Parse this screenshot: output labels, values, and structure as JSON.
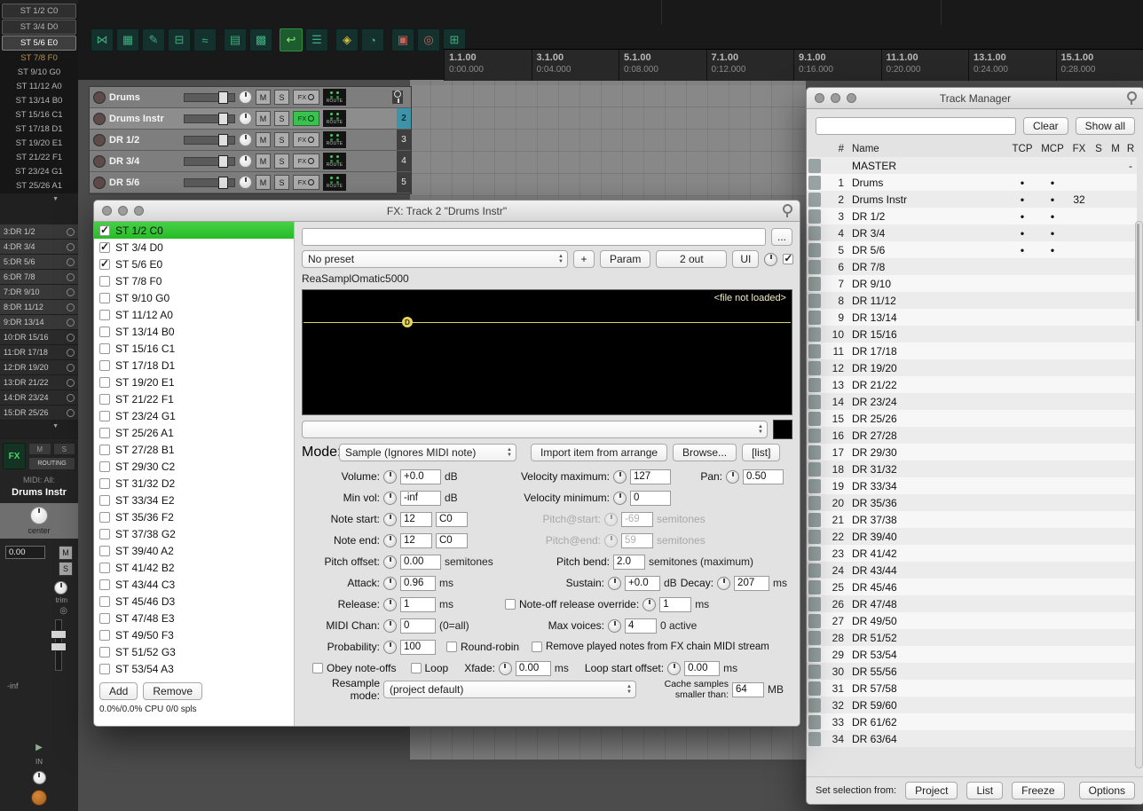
{
  "left_rail": {
    "collapse_arrow": "▼",
    "top_items": [
      {
        "label": "ST 1/2 C0",
        "boxed": true
      },
      {
        "label": "ST 3/4 D0",
        "boxed": true
      },
      {
        "label": "ST 5/6 E0",
        "boxed": true,
        "selected": true
      },
      {
        "label": "ST 7/8 F0",
        "armed": true
      },
      {
        "label": "ST 9/10 G0"
      },
      {
        "label": "ST 11/12 A0"
      },
      {
        "label": "ST 13/14 B0"
      },
      {
        "label": "ST 15/16 C1"
      },
      {
        "label": "ST 17/18 D1"
      },
      {
        "label": "ST 19/20 E1"
      },
      {
        "label": "ST 21/22 F1"
      },
      {
        "label": "ST 23/24 G1"
      },
      {
        "label": "ST 25/26 A1"
      }
    ],
    "dr_items": [
      {
        "label": "3:DR 1/2"
      },
      {
        "label": "4:DR 3/4"
      },
      {
        "label": "5:DR 5/6"
      },
      {
        "label": "6:DR 7/8"
      },
      {
        "label": "7:DR 9/10"
      },
      {
        "label": "8:DR 11/12"
      },
      {
        "label": "9:DR 13/14"
      },
      {
        "label": "10:DR 15/16",
        "dark": true
      },
      {
        "label": "11:DR 17/18",
        "dark": true
      },
      {
        "label": "12:DR 19/20",
        "dark": true
      },
      {
        "label": "13:DR 21/22",
        "dark": true
      },
      {
        "label": "14:DR 23/24",
        "dark": true
      },
      {
        "label": "15:DR 25/26",
        "dark": true
      }
    ],
    "mixer": {
      "fx_label": "FX",
      "mute_label": "M",
      "solo_label": "S",
      "routing_label": "ROUTING",
      "midi_label": "MIDI: All:",
      "track_name": "Drums Instr",
      "pan_label": "center",
      "volume_value": "0.00",
      "trim_label": "trim",
      "meter_label": "-inf",
      "input_label": "IN"
    }
  },
  "toolbar": {
    "items": [
      {
        "name": "crossfade-icon",
        "glyph": "⋈"
      },
      {
        "name": "item-group-icon",
        "glyph": "▦"
      },
      {
        "name": "envelope-pencil-icon",
        "glyph": "✎"
      },
      {
        "name": "split-view-icon",
        "glyph": "⊟"
      },
      {
        "name": "envelope-icon",
        "glyph": "≈"
      },
      {
        "name": "grid-icon",
        "glyph": "▤"
      },
      {
        "name": "snap-grid-icon",
        "glyph": "▩"
      },
      {
        "name": "ripple-edit-icon",
        "glyph": "↩",
        "active": true
      },
      {
        "name": "mixer-list-icon",
        "glyph": "☰"
      },
      {
        "name": "lock-icon",
        "glyph": "◈",
        "gold": true
      },
      {
        "name": "metronome-icon",
        "glyph": "◔"
      },
      {
        "name": "screenset-icon",
        "glyph": "▣",
        "red": true
      },
      {
        "name": "spiral-icon",
        "glyph": "◎",
        "red": true
      },
      {
        "name": "virtual-keyboard-icon",
        "glyph": "⊞"
      }
    ]
  },
  "ruler": {
    "markers": [
      {
        "bar": "1.1.00",
        "time": "0:00.000"
      },
      {
        "bar": "3.1.00",
        "time": "0:04.000"
      },
      {
        "bar": "5.1.00",
        "time": "0:08.000"
      },
      {
        "bar": "7.1.00",
        "time": "0:12.000"
      },
      {
        "bar": "9.1.00",
        "time": "0:16.000"
      },
      {
        "bar": "11.1.00",
        "time": "0:20.000"
      },
      {
        "bar": "13.1.00",
        "time": "0:24.000"
      },
      {
        "bar": "15.1.00",
        "time": "0:28.000"
      }
    ]
  },
  "tracks": {
    "labels": {
      "mute": "M",
      "solo": "S",
      "fx": "FX",
      "route": "ROUTE"
    },
    "rows": [
      {
        "name": "Drums",
        "num": "",
        "pin": true
      },
      {
        "name": "Drums Instr",
        "num": "2",
        "selected": true,
        "fx_on": true
      },
      {
        "name": "DR 1/2",
        "num": "3"
      },
      {
        "name": "DR 3/4",
        "num": "4"
      },
      {
        "name": "DR 5/6",
        "num": "5"
      }
    ]
  },
  "fx_window": {
    "title": "FX: Track 2 \"Drums Instr\"",
    "header": {
      "more_button": "...",
      "preset_value": "No preset",
      "add_preset_button": "+",
      "param_button": "Param",
      "outs_button": "2 out",
      "ui_button": "UI"
    },
    "list": {
      "add_button": "Add",
      "remove_button": "Remove",
      "status": "0.0%/0.0% CPU 0/0 spls",
      "items": [
        {
          "label": "ST 1/2 C0",
          "checked": true,
          "selected": true
        },
        {
          "label": "ST 3/4 D0",
          "checked": true
        },
        {
          "label": "ST 5/6 E0",
          "checked": true
        },
        {
          "label": "ST 7/8 F0"
        },
        {
          "label": "ST 9/10 G0"
        },
        {
          "label": "ST 11/12 A0"
        },
        {
          "label": "ST 13/14 B0"
        },
        {
          "label": "ST 15/16 C1"
        },
        {
          "label": "ST 17/18 D1"
        },
        {
          "label": "ST 19/20 E1"
        },
        {
          "label": "ST 21/22 F1"
        },
        {
          "label": "ST 23/24 G1"
        },
        {
          "label": "ST 25/26 A1"
        },
        {
          "label": "ST 27/28 B1"
        },
        {
          "label": "ST 29/30 C2"
        },
        {
          "label": "ST 31/32 D2"
        },
        {
          "label": "ST 33/34 E2"
        },
        {
          "label": "ST 35/36 F2"
        },
        {
          "label": "ST 37/38 G2"
        },
        {
          "label": "ST 39/40 A2"
        },
        {
          "label": "ST 41/42 B2"
        },
        {
          "label": "ST 43/44 C3"
        },
        {
          "label": "ST 45/46 D3"
        },
        {
          "label": "ST 47/48 E3"
        },
        {
          "label": "ST 49/50 F3"
        },
        {
          "label": "ST 51/52 G3"
        },
        {
          "label": "ST 53/54 A3"
        }
      ]
    },
    "plugin": {
      "name": "ReaSamplOmatic5000",
      "file_status": "<file not loaded>",
      "marker_label": "D",
      "mode_label": "Mode:",
      "mode_value": "Sample (Ignores MIDI note)",
      "import_button": "Import item from arrange",
      "browse_button": "Browse...",
      "list_button": "[list]",
      "volume": {
        "label": "Volume:",
        "value": "+0.0",
        "unit": "dB"
      },
      "velocity_max": {
        "label": "Velocity maximum:",
        "value": "127"
      },
      "pan": {
        "label": "Pan:",
        "value": "0.50"
      },
      "min_vol": {
        "label": "Min vol:",
        "value": "-inf",
        "unit": "dB"
      },
      "velocity_min": {
        "label": "Velocity minimum:",
        "value": "0"
      },
      "note_start": {
        "label": "Note start:",
        "value": "12",
        "note": "C0"
      },
      "pitch_start": {
        "label": "Pitch@start:",
        "value": "-69",
        "unit": "semitones"
      },
      "note_end": {
        "label": "Note end:",
        "value": "12",
        "note": "C0"
      },
      "pitch_end": {
        "label": "Pitch@end:",
        "value": "59",
        "unit": "semitones"
      },
      "pitch_offset": {
        "label": "Pitch offset:",
        "value": "0.00",
        "unit": "semitones"
      },
      "pitch_bend": {
        "label": "Pitch bend:",
        "value": "2.0",
        "unit": "semitones (maximum)"
      },
      "attack": {
        "label": "Attack:",
        "value": "0.96",
        "unit": "ms"
      },
      "sustain": {
        "label": "Sustain:",
        "value": "+0.0",
        "unit": "dB"
      },
      "decay": {
        "label": "Decay:",
        "value": "207",
        "unit": "ms"
      },
      "release": {
        "label": "Release:",
        "value": "1",
        "unit": "ms"
      },
      "noteoff_override": {
        "label": "Note-off release override:",
        "value": "1",
        "unit": "ms"
      },
      "midi_chan": {
        "label": "MIDI Chan:",
        "value": "0",
        "unit": "(0=all)"
      },
      "max_voices": {
        "label": "Max voices:",
        "value": "4",
        "unit": "0 active"
      },
      "probability": {
        "label": "Probability:",
        "value": "100"
      },
      "round_robin_label": "Round-robin",
      "remove_played_label": "Remove played notes from FX chain MIDI stream",
      "obey_label": "Obey note-offs",
      "loop_label": "Loop",
      "xfade": {
        "label": "Xfade:",
        "value": "0.00",
        "unit": "ms"
      },
      "loop_start": {
        "label": "Loop start offset:",
        "value": "0.00",
        "unit": "ms"
      },
      "resample_label": "Resample mode:",
      "resample_value": "(project default)",
      "cache_label": "Cache samples smaller than:",
      "cache_value": "64",
      "cache_unit": "MB"
    }
  },
  "track_manager": {
    "title": "Track Manager",
    "clear_button": "Clear",
    "show_all_button": "Show all",
    "columns": {
      "num": "#",
      "name": "Name",
      "tcp": "TCP",
      "mcp": "MCP",
      "fx": "FX",
      "s": "S",
      "m": "M",
      "r": "R"
    },
    "footer": {
      "label": "Set selection from:",
      "project": "Project",
      "list": "List",
      "freeze": "Freeze",
      "options": "Options"
    },
    "rows": [
      {
        "num": "",
        "name": "MASTER",
        "tcp": "",
        "mcp": "",
        "fx": "",
        "s": "",
        "m": "",
        "r": "-"
      },
      {
        "num": "1",
        "name": "Drums",
        "tcp": "•",
        "mcp": "•",
        "fx": "",
        "s": "",
        "m": "",
        "r": ""
      },
      {
        "num": "2",
        "name": "Drums Instr",
        "tcp": "•",
        "mcp": "•",
        "fx": "32",
        "s": "",
        "m": "",
        "r": ""
      },
      {
        "num": "3",
        "name": "DR 1/2",
        "tcp": "•",
        "mcp": "•",
        "fx": "",
        "s": "",
        "m": "",
        "r": ""
      },
      {
        "num": "4",
        "name": "DR 3/4",
        "tcp": "•",
        "mcp": "•",
        "fx": "",
        "s": "",
        "m": "",
        "r": ""
      },
      {
        "num": "5",
        "name": "DR 5/6",
        "tcp": "•",
        "mcp": "•",
        "fx": "",
        "s": "",
        "m": "",
        "r": ""
      },
      {
        "num": "6",
        "name": "DR 7/8",
        "tcp": "",
        "mcp": "",
        "fx": "",
        "s": "",
        "m": "",
        "r": ""
      },
      {
        "num": "7",
        "name": "DR 9/10",
        "tcp": "",
        "mcp": "",
        "fx": "",
        "s": "",
        "m": "",
        "r": ""
      },
      {
        "num": "8",
        "name": "DR 11/12",
        "tcp": "",
        "mcp": "",
        "fx": "",
        "s": "",
        "m": "",
        "r": ""
      },
      {
        "num": "9",
        "name": "DR 13/14",
        "tcp": "",
        "mcp": "",
        "fx": "",
        "s": "",
        "m": "",
        "r": ""
      },
      {
        "num": "10",
        "name": "DR 15/16",
        "tcp": "",
        "mcp": "",
        "fx": "",
        "s": "",
        "m": "",
        "r": ""
      },
      {
        "num": "11",
        "name": "DR 17/18",
        "tcp": "",
        "mcp": "",
        "fx": "",
        "s": "",
        "m": "",
        "r": ""
      },
      {
        "num": "12",
        "name": "DR 19/20",
        "tcp": "",
        "mcp": "",
        "fx": "",
        "s": "",
        "m": "",
        "r": ""
      },
      {
        "num": "13",
        "name": "DR 21/22",
        "tcp": "",
        "mcp": "",
        "fx": "",
        "s": "",
        "m": "",
        "r": ""
      },
      {
        "num": "14",
        "name": "DR 23/24",
        "tcp": "",
        "mcp": "",
        "fx": "",
        "s": "",
        "m": "",
        "r": ""
      },
      {
        "num": "15",
        "name": "DR 25/26",
        "tcp": "",
        "mcp": "",
        "fx": "",
        "s": "",
        "m": "",
        "r": ""
      },
      {
        "num": "16",
        "name": "DR 27/28",
        "tcp": "",
        "mcp": "",
        "fx": "",
        "s": "",
        "m": "",
        "r": ""
      },
      {
        "num": "17",
        "name": "DR 29/30",
        "tcp": "",
        "mcp": "",
        "fx": "",
        "s": "",
        "m": "",
        "r": ""
      },
      {
        "num": "18",
        "name": "DR 31/32",
        "tcp": "",
        "mcp": "",
        "fx": "",
        "s": "",
        "m": "",
        "r": ""
      },
      {
        "num": "19",
        "name": "DR 33/34",
        "tcp": "",
        "mcp": "",
        "fx": "",
        "s": "",
        "m": "",
        "r": ""
      },
      {
        "num": "20",
        "name": "DR 35/36",
        "tcp": "",
        "mcp": "",
        "fx": "",
        "s": "",
        "m": "",
        "r": ""
      },
      {
        "num": "21",
        "name": "DR 37/38",
        "tcp": "",
        "mcp": "",
        "fx": "",
        "s": "",
        "m": "",
        "r": ""
      },
      {
        "num": "22",
        "name": "DR 39/40",
        "tcp": "",
        "mcp": "",
        "fx": "",
        "s": "",
        "m": "",
        "r": ""
      },
      {
        "num": "23",
        "name": "DR 41/42",
        "tcp": "",
        "mcp": "",
        "fx": "",
        "s": "",
        "m": "",
        "r": ""
      },
      {
        "num": "24",
        "name": "DR 43/44",
        "tcp": "",
        "mcp": "",
        "fx": "",
        "s": "",
        "m": "",
        "r": ""
      },
      {
        "num": "25",
        "name": "DR 45/46",
        "tcp": "",
        "mcp": "",
        "fx": "",
        "s": "",
        "m": "",
        "r": ""
      },
      {
        "num": "26",
        "name": "DR 47/48",
        "tcp": "",
        "mcp": "",
        "fx": "",
        "s": "",
        "m": "",
        "r": ""
      },
      {
        "num": "27",
        "name": "DR 49/50",
        "tcp": "",
        "mcp": "",
        "fx": "",
        "s": "",
        "m": "",
        "r": ""
      },
      {
        "num": "28",
        "name": "DR 51/52",
        "tcp": "",
        "mcp": "",
        "fx": "",
        "s": "",
        "m": "",
        "r": ""
      },
      {
        "num": "29",
        "name": "DR 53/54",
        "tcp": "",
        "mcp": "",
        "fx": "",
        "s": "",
        "m": "",
        "r": ""
      },
      {
        "num": "30",
        "name": "DR 55/56",
        "tcp": "",
        "mcp": "",
        "fx": "",
        "s": "",
        "m": "",
        "r": ""
      },
      {
        "num": "31",
        "name": "DR 57/58",
        "tcp": "",
        "mcp": "",
        "fx": "",
        "s": "",
        "m": "",
        "r": ""
      },
      {
        "num": "32",
        "name": "DR 59/60",
        "tcp": "",
        "mcp": "",
        "fx": "",
        "s": "",
        "m": "",
        "r": ""
      },
      {
        "num": "33",
        "name": "DR 61/62",
        "tcp": "",
        "mcp": "",
        "fx": "",
        "s": "",
        "m": "",
        "r": ""
      },
      {
        "num": "34",
        "name": "DR 63/64",
        "tcp": "",
        "mcp": "",
        "fx": "",
        "s": "",
        "m": "",
        "r": ""
      }
    ]
  }
}
